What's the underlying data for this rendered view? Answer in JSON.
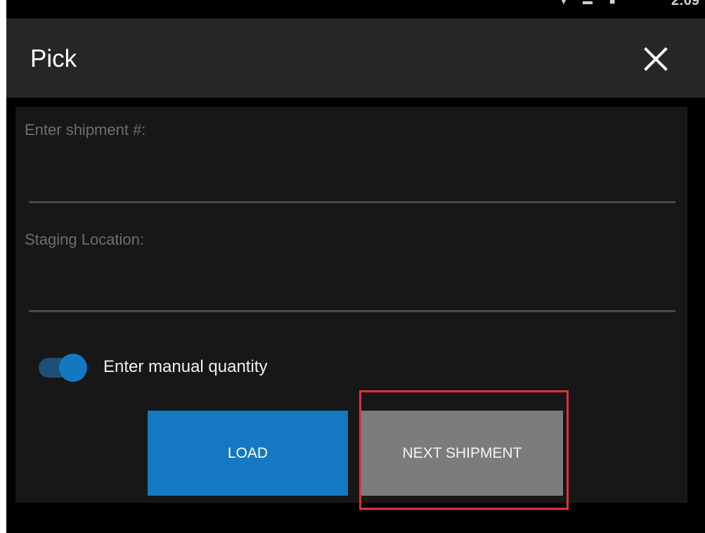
{
  "app_bar": {
    "title": "Pick",
    "close_icon": "close-icon"
  },
  "status_bar": {
    "time": "2:09",
    "icons": [
      "wifi-icon",
      "signal-icon",
      "battery-icon"
    ]
  },
  "form": {
    "shipment": {
      "label": "Enter shipment #:",
      "value": ""
    },
    "staging": {
      "label": "Staging Location:",
      "value": ""
    },
    "manual_quantity": {
      "label": "Enter manual quantity",
      "enabled": true
    }
  },
  "buttons": {
    "load": "LOAD",
    "next_shipment": "NEXT SHIPMENT"
  },
  "colors": {
    "accent": "#1478c3",
    "app_bar": "#262626",
    "panel": "#171717",
    "secondary_button": "#7c7c7c",
    "highlight": "#e0303c"
  }
}
